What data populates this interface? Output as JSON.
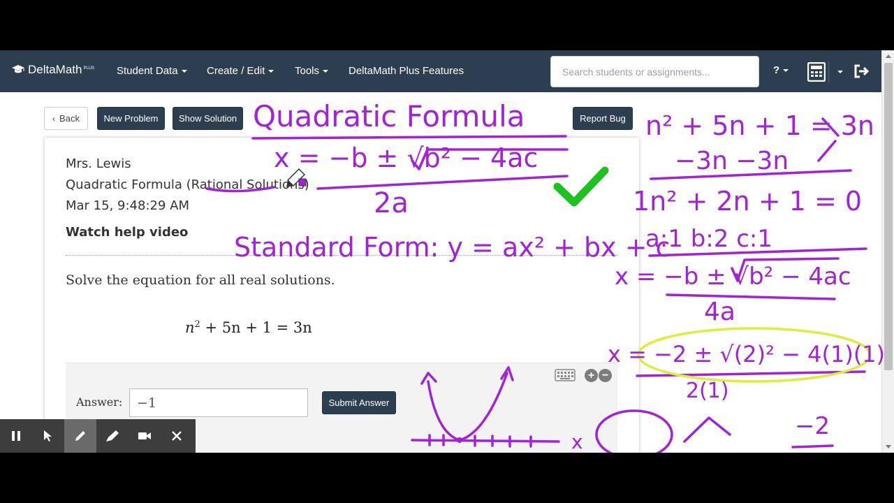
{
  "navbar": {
    "brand": "DeltaMath",
    "brand_sup": "PLUS",
    "items": [
      "Student Data",
      "Create / Edit",
      "Tools",
      "DeltaMath Plus Features"
    ],
    "search_placeholder": "Search students or assignments...",
    "help": "?"
  },
  "toolbar": {
    "back": "Back",
    "new_problem": "New Problem",
    "show_solution": "Show Solution",
    "report_bug": "Report Bug"
  },
  "problem": {
    "teacher": "Mrs. Lewis",
    "topic": "Quadratic Formula (Rational Solutions)",
    "timestamp": "Mar 15, 9:48:29 AM",
    "watch_video": "Watch help video",
    "prompt": "Solve the equation for all real solutions.",
    "equation": {
      "n": "n",
      "sq": "2",
      "rest": "+ 5n + 1 = 3n"
    }
  },
  "answer": {
    "label": "Answer:",
    "value": "−1",
    "submit": "Submit Answer"
  },
  "annotations": {
    "title": "Quadratic Formula",
    "formula_left": "x = −b ± √b² − 4ac",
    "formula_denom": "2a",
    "standard_form": "Standard Form: y = ax² + bx + c",
    "eq1": "n² + 5n + 1 = 3n",
    "eq1_sub": "−3n       −3n",
    "eq2": "1n² + 2n + 1 = 0",
    "coeffs": "a:1   b:2   c:1",
    "formula2": "x = −b ± √b² − 4ac",
    "formula2_denom": "4a",
    "subst": "x = −2 ± √(2)² − 4(1)(1)",
    "subst_denom": "2(1)",
    "last_x": "x",
    "last_frac": "−2"
  },
  "colors": {
    "navbar": "#2d3e50",
    "ink": "#a321d6",
    "check": "#1ec21e",
    "highlight": "#dcee3a"
  }
}
